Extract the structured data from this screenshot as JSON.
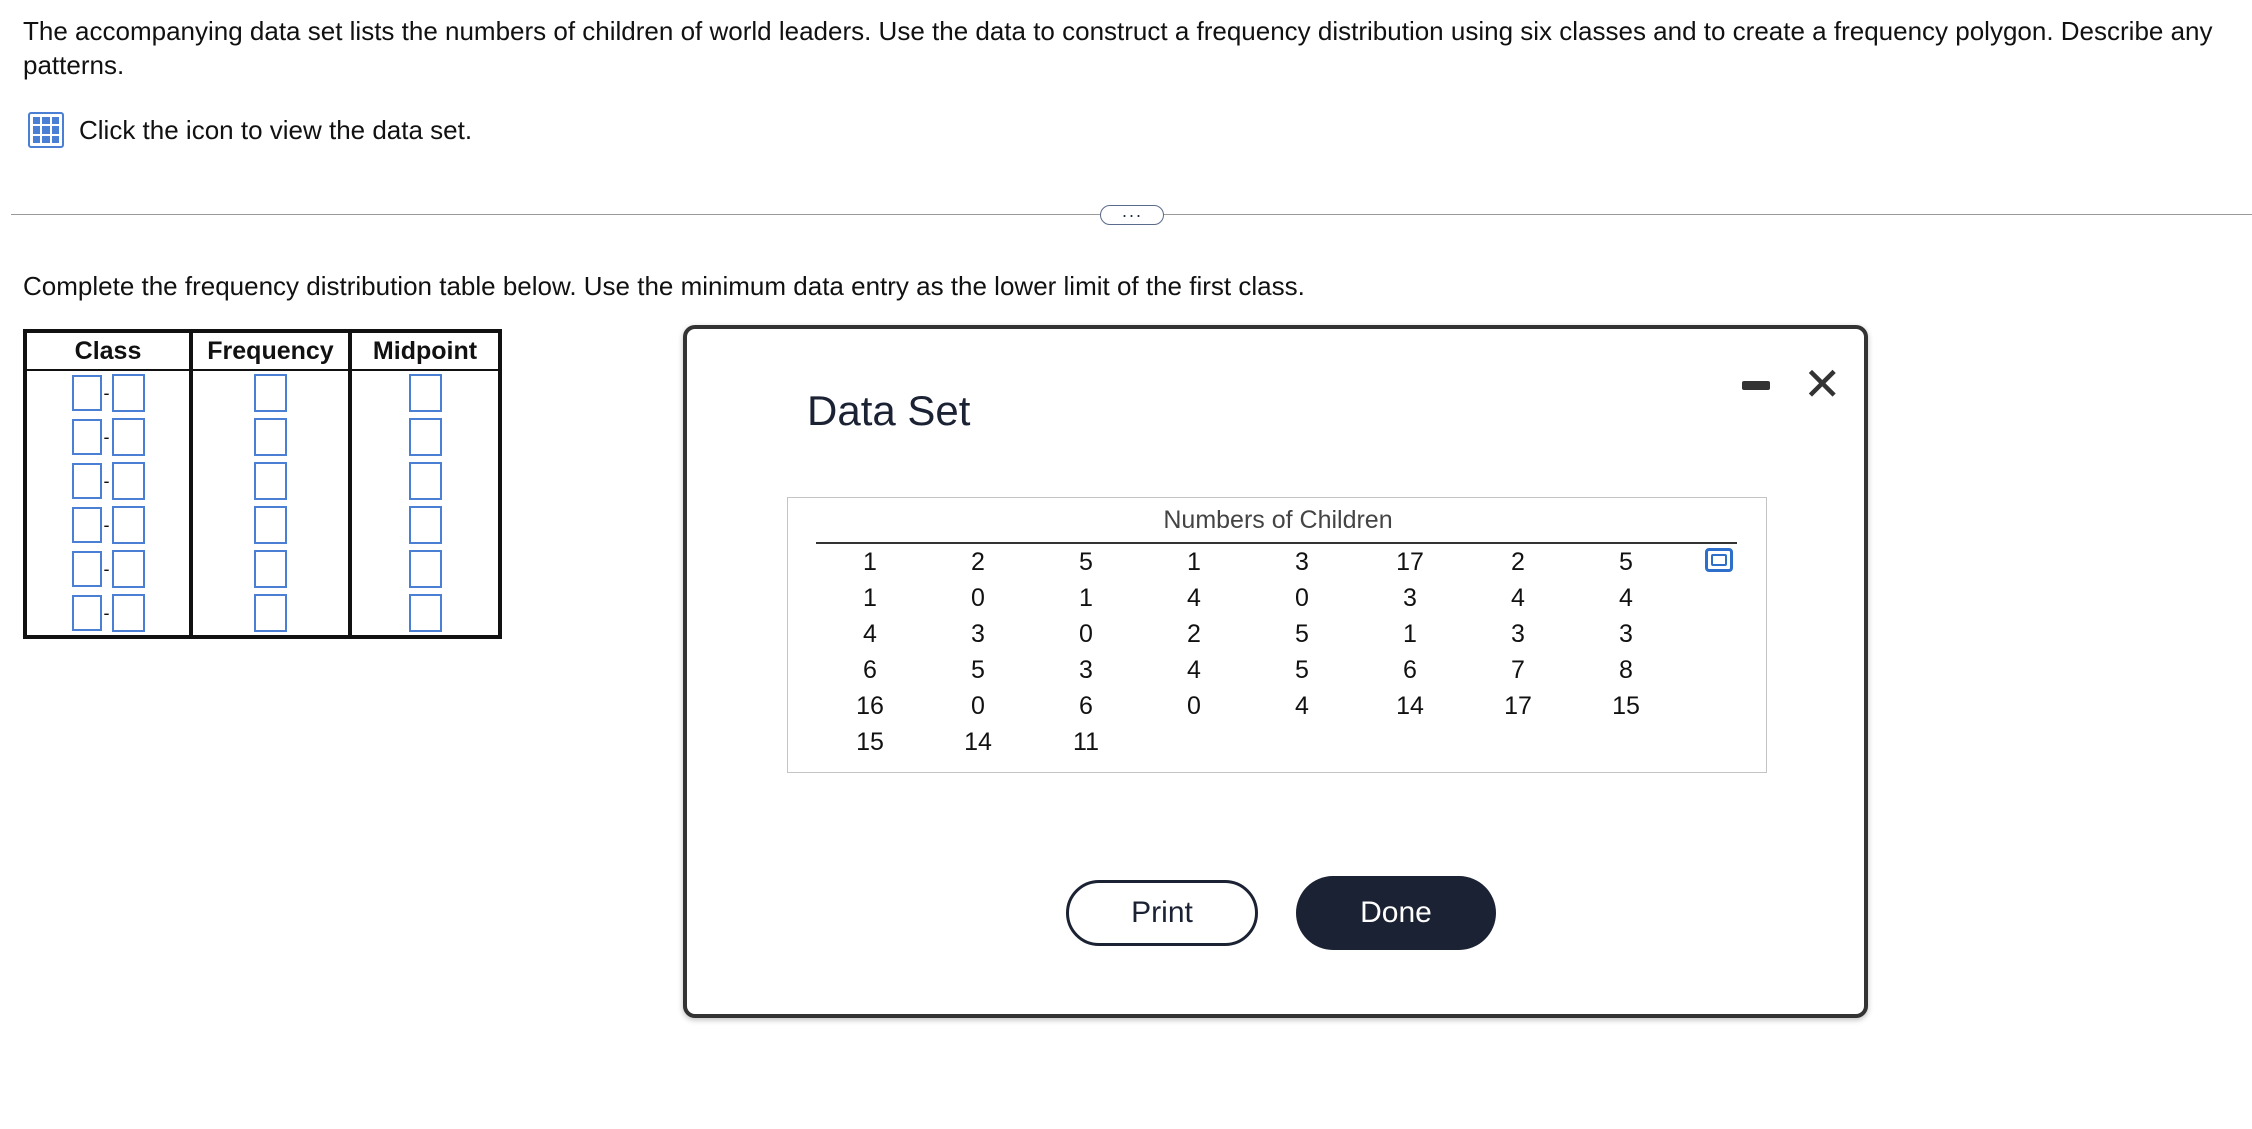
{
  "question": {
    "text": "The accompanying data set lists the numbers of children of world leaders. Use the data to construct a frequency distribution using six classes and to create a frequency polygon. Describe any patterns."
  },
  "dataset_link": {
    "icon": "table-grid-icon",
    "label": "Click the icon to view the data set."
  },
  "more_button": {
    "label": "···"
  },
  "instruction": "Complete the frequency distribution table below. Use the minimum data entry as the lower limit of the first class.",
  "freq_table": {
    "headers": {
      "class": "Class",
      "frequency": "Frequency",
      "midpoint": "Midpoint"
    },
    "separator": "-",
    "rows": [
      {
        "lower": "",
        "upper": "",
        "frequency": "",
        "midpoint": ""
      },
      {
        "lower": "",
        "upper": "",
        "frequency": "",
        "midpoint": ""
      },
      {
        "lower": "",
        "upper": "",
        "frequency": "",
        "midpoint": ""
      },
      {
        "lower": "",
        "upper": "",
        "frequency": "",
        "midpoint": ""
      },
      {
        "lower": "",
        "upper": "",
        "frequency": "",
        "midpoint": ""
      },
      {
        "lower": "",
        "upper": "",
        "frequency": "",
        "midpoint": ""
      }
    ]
  },
  "modal": {
    "title": "Data Set",
    "caption": "Numbers of Children",
    "rows": [
      [
        "1",
        "2",
        "5",
        "1",
        "3",
        "17",
        "2",
        "5"
      ],
      [
        "1",
        "0",
        "1",
        "4",
        "0",
        "3",
        "4",
        "4"
      ],
      [
        "4",
        "3",
        "0",
        "2",
        "5",
        "1",
        "3",
        "3"
      ],
      [
        "6",
        "5",
        "3",
        "4",
        "5",
        "6",
        "7",
        "8"
      ],
      [
        "16",
        "0",
        "6",
        "0",
        "4",
        "14",
        "17",
        "15"
      ],
      [
        "15",
        "14",
        "11",
        "",
        "",
        "",
        "",
        ""
      ]
    ],
    "print_label": "Print",
    "done_label": "Done",
    "icons": {
      "minimize": "minimize-icon",
      "close": "close-icon",
      "copy": "copy-icon"
    }
  }
}
